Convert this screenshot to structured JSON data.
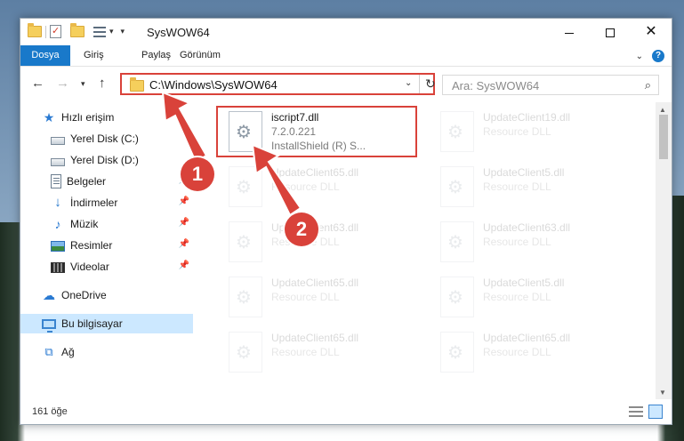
{
  "window": {
    "title": "SysWOW64"
  },
  "ribbon": {
    "tabs": [
      "Dosya",
      "Giriş",
      "Paylaş",
      "Görünüm"
    ]
  },
  "address": {
    "path": "C:\\Windows\\SysWOW64"
  },
  "search": {
    "placeholder": "Ara: SysWOW64"
  },
  "sidebar": {
    "items": [
      {
        "label": "Hızlı erişim",
        "icon": "star-icon"
      },
      {
        "label": "Yerel Disk (C:)",
        "icon": "disk-icon"
      },
      {
        "label": "Yerel Disk (D:)",
        "icon": "disk-icon"
      },
      {
        "label": "Belgeler",
        "icon": "document-icon"
      },
      {
        "label": "İndirmeler",
        "icon": "download-icon"
      },
      {
        "label": "Müzik",
        "icon": "music-icon"
      },
      {
        "label": "Resimler",
        "icon": "pictures-icon"
      },
      {
        "label": "Videolar",
        "icon": "video-icon"
      },
      {
        "label": "OneDrive",
        "icon": "cloud-icon"
      },
      {
        "label": "Bu bilgisayar",
        "icon": "computer-icon"
      },
      {
        "label": "Ağ",
        "icon": "network-icon"
      }
    ],
    "selected": "Bu bilgisayar"
  },
  "files": {
    "highlighted": {
      "name": "iscript7.dll",
      "version": "7.2.0.221",
      "description": "InstallShield (R) S..."
    },
    "background": [
      {
        "name": "UpdateClient19.dll",
        "type": "Resource DLL"
      },
      {
        "name": "UpdateClient65.dll",
        "type": "Resource DLL"
      },
      {
        "name": "UpdateClient5.dll",
        "type": "Resource DLL"
      },
      {
        "name": "UpdateClient63.dll",
        "type": "Resource DLL"
      },
      {
        "name": "UpdateClient63.dll",
        "type": "Resource DLL"
      },
      {
        "name": "UpdateClient65.dll",
        "type": "Resource DLL"
      },
      {
        "name": "UpdateClient5.dll",
        "type": "Resource DLL"
      },
      {
        "name": "UpdateClient65.dll",
        "type": "Resource DLL"
      },
      {
        "name": "UpdateClient65.dll",
        "type": "Resource DLL"
      }
    ]
  },
  "status": {
    "count": "161 öğe"
  },
  "annotations": {
    "markers": [
      "1",
      "2"
    ],
    "color": "#d9423a"
  },
  "colors": {
    "accent": "#1979ca",
    "selection": "#cce8ff",
    "highlight": "#d9423a"
  }
}
